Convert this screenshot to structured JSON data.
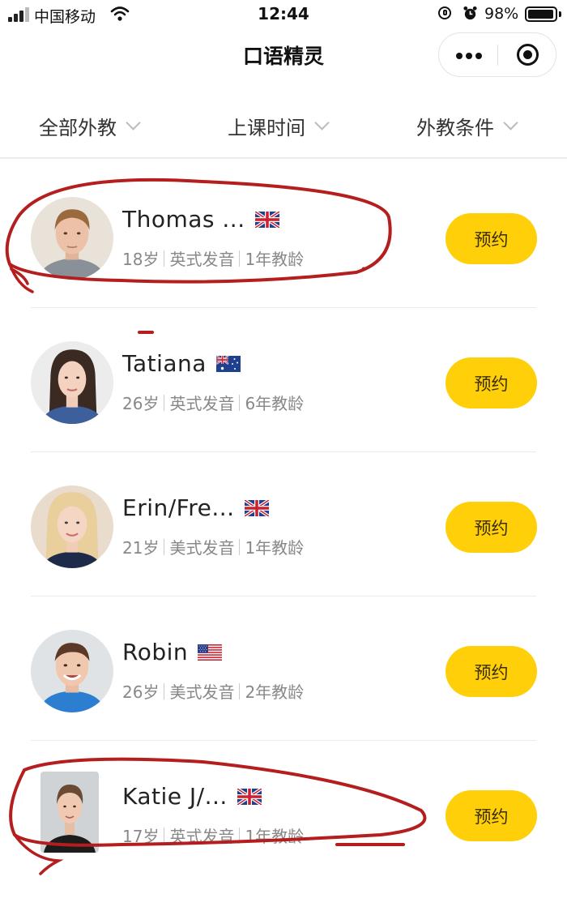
{
  "status_bar": {
    "carrier": "中国移动",
    "time": "12:44",
    "battery": "98%",
    "battery_level": 0.98
  },
  "nav": {
    "title": "口语精灵"
  },
  "filters": [
    {
      "label": "全部外教"
    },
    {
      "label": "上课时间"
    },
    {
      "label": "外教条件"
    }
  ],
  "teachers": [
    {
      "name": "Thomas ...",
      "flag": "uk-flag-icon",
      "age": "18岁",
      "accent": "英式发音",
      "experience": "1年教龄",
      "button": "预约"
    },
    {
      "name": "Tatiana",
      "flag": "australia-flag-icon",
      "age": "26岁",
      "accent": "英式发音",
      "experience": "6年教龄",
      "button": "预约"
    },
    {
      "name": "Erin/Fre...",
      "flag": "uk-flag-icon",
      "age": "21岁",
      "accent": "美式发音",
      "experience": "1年教龄",
      "button": "预约"
    },
    {
      "name": "Robin",
      "flag": "us-flag-icon",
      "age": "26岁",
      "accent": "美式发音",
      "experience": "2年教龄",
      "button": "预约"
    },
    {
      "name": "Katie J/...",
      "flag": "uk-flag-icon",
      "age": "17岁",
      "accent": "英式发音",
      "experience": "1年教龄",
      "button": "预约"
    }
  ],
  "colors": {
    "book_button": "#FFD00A",
    "annotation_ink": "#B41E1E"
  }
}
